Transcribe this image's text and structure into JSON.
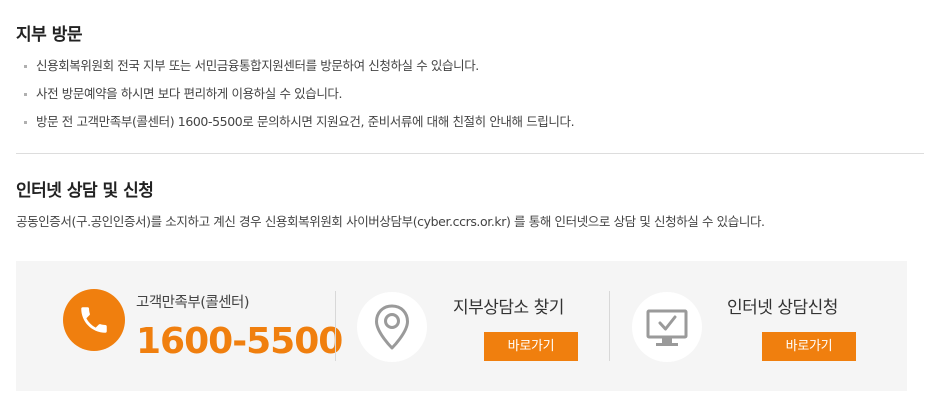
{
  "visit": {
    "title": "지부 방문",
    "items": [
      "신용회복위원회 전국 지부 또는 서민금융통합지원센터를 방문하여 신청하실 수 있습니다.",
      "사전 방문예약을 하시면 보다 편리하게 이용하실 수 있습니다.",
      "방문 전 고객만족부(콜센터) 1600-5500로 문의하시면 지원요건, 준비서류에 대해 친절히 안내해 드립니다."
    ]
  },
  "internet": {
    "title": "인터넷 상담 및 신청",
    "description": "공동인증서(구.공인인증서)를 소지하고 계신 경우 신용회복위원회 사이버상담부(cyber.ccrs.or.kr) 를 통해 인터넷으로 상담 및 신청하실 수 있습니다."
  },
  "contact": {
    "call_center_label": "고객만족부(콜센터)",
    "call_center_number": "1600-5500",
    "branch_finder": {
      "title": "지부상담소 찾기",
      "button": "바로가기"
    },
    "internet_apply": {
      "title": "인터넷 상담신청",
      "button": "바로가기"
    }
  },
  "colors": {
    "accent": "#f07f0e",
    "panel_bg": "#f5f5f5",
    "icon_gray": "#9a9a9a"
  },
  "icons": [
    "phone-icon",
    "map-pin-icon",
    "monitor-check-icon"
  ]
}
